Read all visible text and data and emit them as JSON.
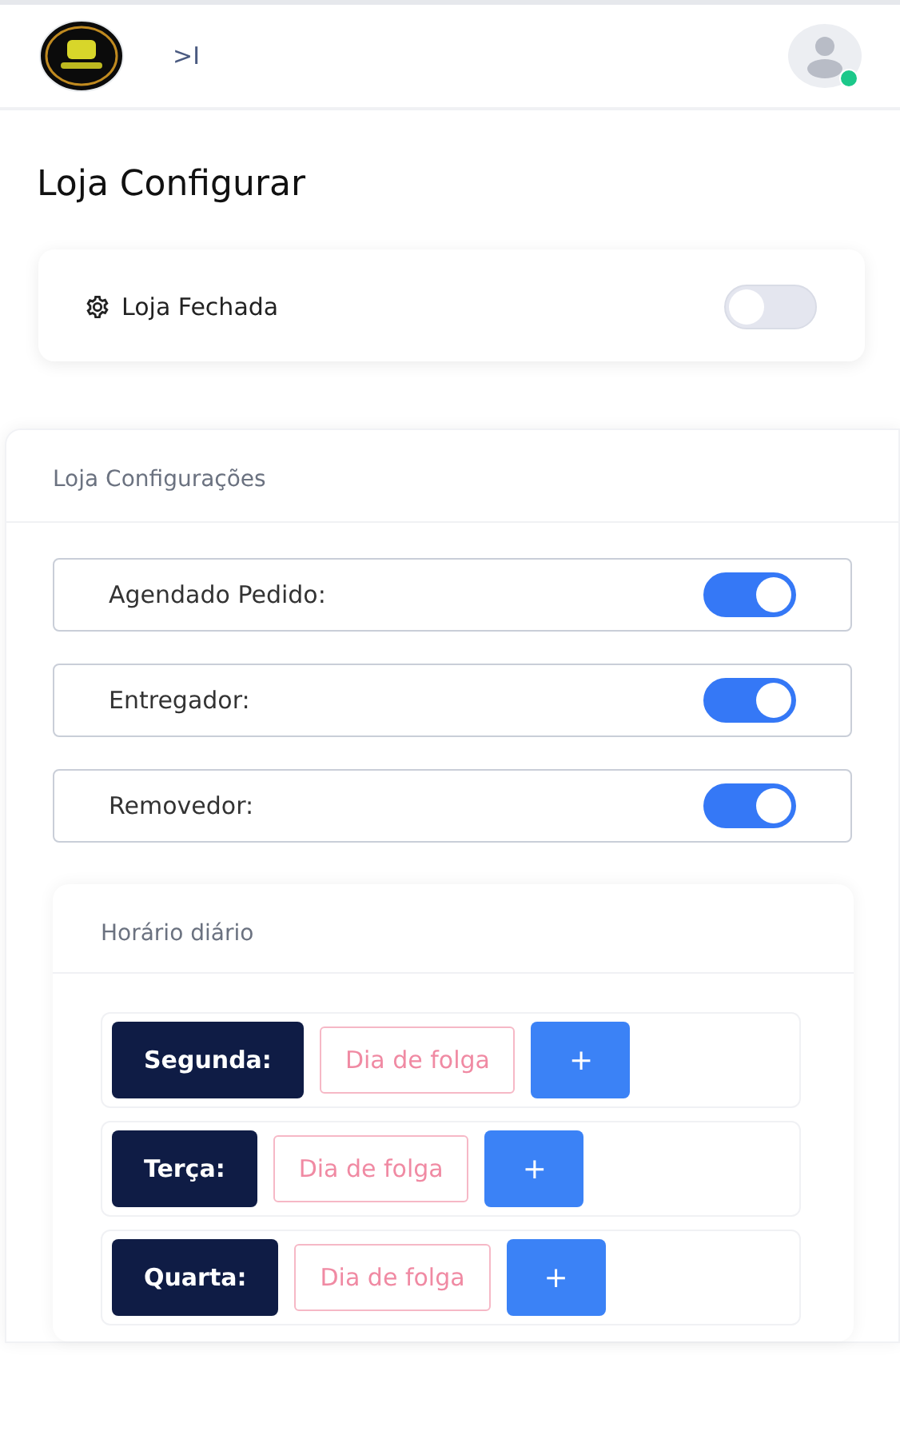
{
  "header": {
    "collapse_glyph": ">I",
    "user_online": true
  },
  "title": "Loja Configurar",
  "store_closed": {
    "label": "Loja Fechada",
    "on": false
  },
  "settings": {
    "title": "Loja Configurações",
    "toggles": [
      {
        "label": "Agendado Pedido:",
        "on": true
      },
      {
        "label": "Entregador:",
        "on": true
      },
      {
        "label": "Removedor:",
        "on": true
      }
    ],
    "schedule": {
      "title": "Horário diário",
      "days": [
        {
          "day": "Segunda:",
          "status": "Dia de folga",
          "add": "+"
        },
        {
          "day": "Terça:",
          "status": "Dia de folga",
          "add": "+"
        },
        {
          "day": "Quarta:",
          "status": "Dia de folga",
          "add": "+"
        }
      ]
    }
  }
}
